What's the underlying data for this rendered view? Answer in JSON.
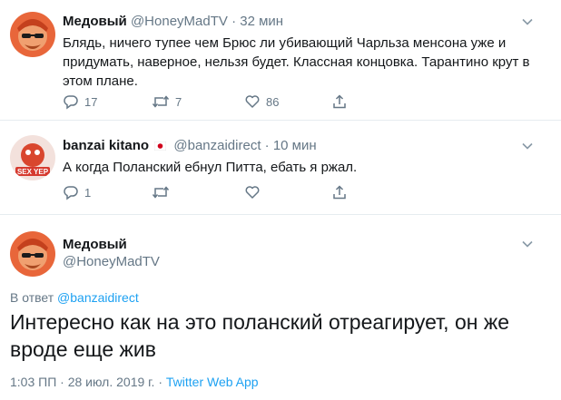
{
  "tweet1": {
    "name": "Медовый",
    "handle": "@HoneyMadTV",
    "separator": "·",
    "time": "32 мин",
    "text_lines": [
      "Блядь, ничего тупее чем Брюс ли убивающий Чарльза менсона уже и",
      "придумать, наверное, нельзя будет. Классная концовка. Тарантино крут в",
      "этом плане."
    ],
    "replies": "17",
    "retweets": "7",
    "likes": "86"
  },
  "tweet2": {
    "name": "banzai kitano",
    "flag_icon": "japan-flag-icon",
    "handle": "@banzaidirect",
    "separator": "·",
    "time": "10 мин",
    "avatar_badge": "SEX YEP",
    "text": "А когда Поланский ебнул Питта, ебать я ржал.",
    "replies": "1"
  },
  "tweet3": {
    "name": "Медовый",
    "handle": "@HoneyMadTV",
    "reply_prefix": "В ответ",
    "reply_to": "@banzaidirect",
    "text_lines": [
      "Интересно как на это поланский отреагирует, он же",
      "вроде еще жив"
    ],
    "timestamp": "1:03 ПП · 28 июл. 2019 г. · ",
    "source": "Twitter Web App"
  },
  "colors": {
    "text": "#14171a",
    "secondary": "#657786",
    "link": "#1da1f2",
    "separator": "#e6ecf0"
  }
}
